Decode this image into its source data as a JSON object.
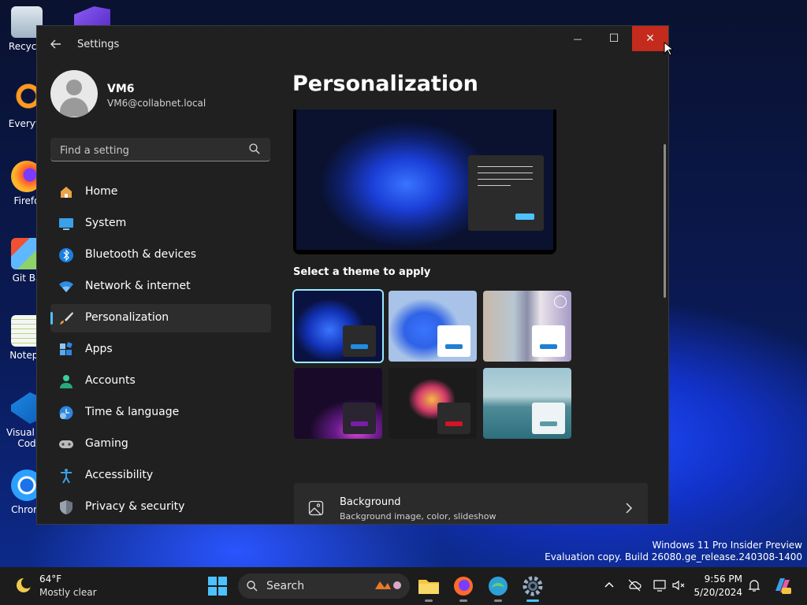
{
  "desktop": {
    "icons": [
      "Recycle",
      "Everyth",
      "Firefo",
      "Git Ba",
      "Notepa",
      "Visual St Cod",
      "Chrom"
    ],
    "watermark_line1": "Windows 11 Pro Insider Preview",
    "watermark_line2": "Evaluation copy. Build 26080.ge_release.240308-1400"
  },
  "window": {
    "title": "Settings",
    "minimize": "—",
    "maximize": "☐",
    "close": "✕"
  },
  "user": {
    "name": "VM6",
    "email": "VM6@collabnet.local"
  },
  "search": {
    "placeholder": "Find a setting"
  },
  "nav": {
    "items": [
      {
        "label": "Home",
        "icon": "home-icon"
      },
      {
        "label": "System",
        "icon": "system-icon"
      },
      {
        "label": "Bluetooth & devices",
        "icon": "bluetooth-icon"
      },
      {
        "label": "Network & internet",
        "icon": "wifi-icon"
      },
      {
        "label": "Personalization",
        "icon": "brush-icon",
        "active": true
      },
      {
        "label": "Apps",
        "icon": "apps-icon"
      },
      {
        "label": "Accounts",
        "icon": "accounts-icon"
      },
      {
        "label": "Time & language",
        "icon": "globe-clock-icon"
      },
      {
        "label": "Gaming",
        "icon": "gamepad-icon"
      },
      {
        "label": "Accessibility",
        "icon": "accessibility-icon"
      },
      {
        "label": "Privacy & security",
        "icon": "shield-icon"
      }
    ]
  },
  "main": {
    "title": "Personalization",
    "theme_heading": "Select a theme to apply",
    "background_card": {
      "title": "Background",
      "subtitle": "Background image, color, slideshow"
    }
  },
  "colors": {
    "accent": "#4cc2ff",
    "close": "#c42b1c",
    "window_bg": "#202020"
  },
  "taskbar": {
    "temperature": "64°F",
    "condition": "Mostly clear",
    "search_label": "Search",
    "time": "9:56 PM",
    "date": "5/20/2024"
  }
}
